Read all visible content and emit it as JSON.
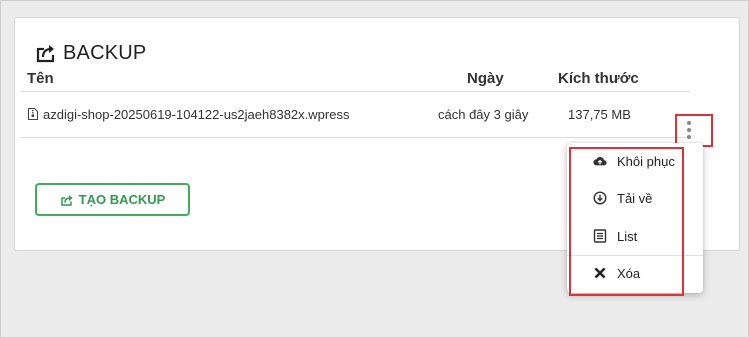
{
  "section": {
    "title": "BACKUP"
  },
  "table": {
    "headers": {
      "name": "Tên",
      "date": "Ngày",
      "size": "Kích thước"
    },
    "rows": [
      {
        "name": "azdigi-shop-20250619-104122-us2jaeh8382x.wpress",
        "date": "cách đây 3 giây",
        "size": "137,75 MB"
      }
    ]
  },
  "actions": {
    "create_backup_label": "TẠO BACKUP"
  },
  "menu": {
    "items": [
      {
        "label": "Khôi phục",
        "icon": "cloud-upload-icon"
      },
      {
        "label": "Tải về",
        "icon": "download-circle-icon"
      },
      {
        "label": "List",
        "icon": "list-icon"
      },
      {
        "label": "Xóa",
        "icon": "close-icon"
      }
    ]
  },
  "colors": {
    "accent_green": "#2e9c4d",
    "highlight_red": "#e0303a"
  }
}
